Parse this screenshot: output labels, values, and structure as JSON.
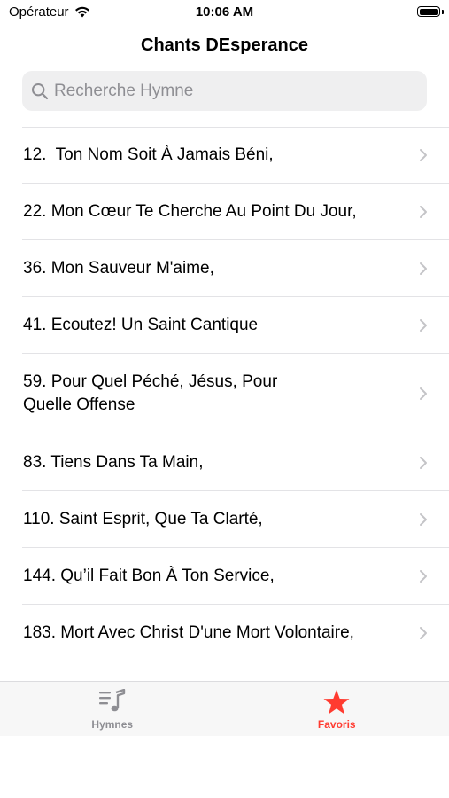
{
  "status_bar": {
    "carrier": "Opérateur",
    "time": "10:06 AM",
    "wifi_icon": "wifi-icon",
    "battery_icon": "battery-icon",
    "battery_level": 1.0
  },
  "nav": {
    "title": "Chants DEsperance"
  },
  "search": {
    "placeholder": "Recherche Hymne",
    "value": "",
    "icon": "search-icon"
  },
  "hymns": [
    {
      "label": "12.  Ton Nom Soit À Jamais Béni,"
    },
    {
      "label": "22. Mon Cœur Te Cherche Au Point Du Jour,"
    },
    {
      "label": "36. Mon Sauveur M'aime,"
    },
    {
      "label": "41. Ecoutez! Un Saint Cantique"
    },
    {
      "label": "59. Pour Quel Péché, Jésus, Pour\nQuelle Offense"
    },
    {
      "label": "83. Tiens Dans Ta Main,"
    },
    {
      "label": "110. Saint Esprit, Que Ta Clarté,"
    },
    {
      "label": "144. Qu’il Fait Bon À Ton Service,"
    },
    {
      "label": "183. Mort Avec Christ D'une Mort Volontaire,"
    }
  ],
  "tab_bar": {
    "tabs": [
      {
        "label": "Hymnes",
        "icon": "music-list-icon",
        "selected": false
      },
      {
        "label": "Favoris",
        "icon": "star-icon",
        "selected": true
      }
    ]
  },
  "colors": {
    "accent": "#ff3b30",
    "inactive": "#8e8e93",
    "chevron": "#c4c4c7"
  }
}
